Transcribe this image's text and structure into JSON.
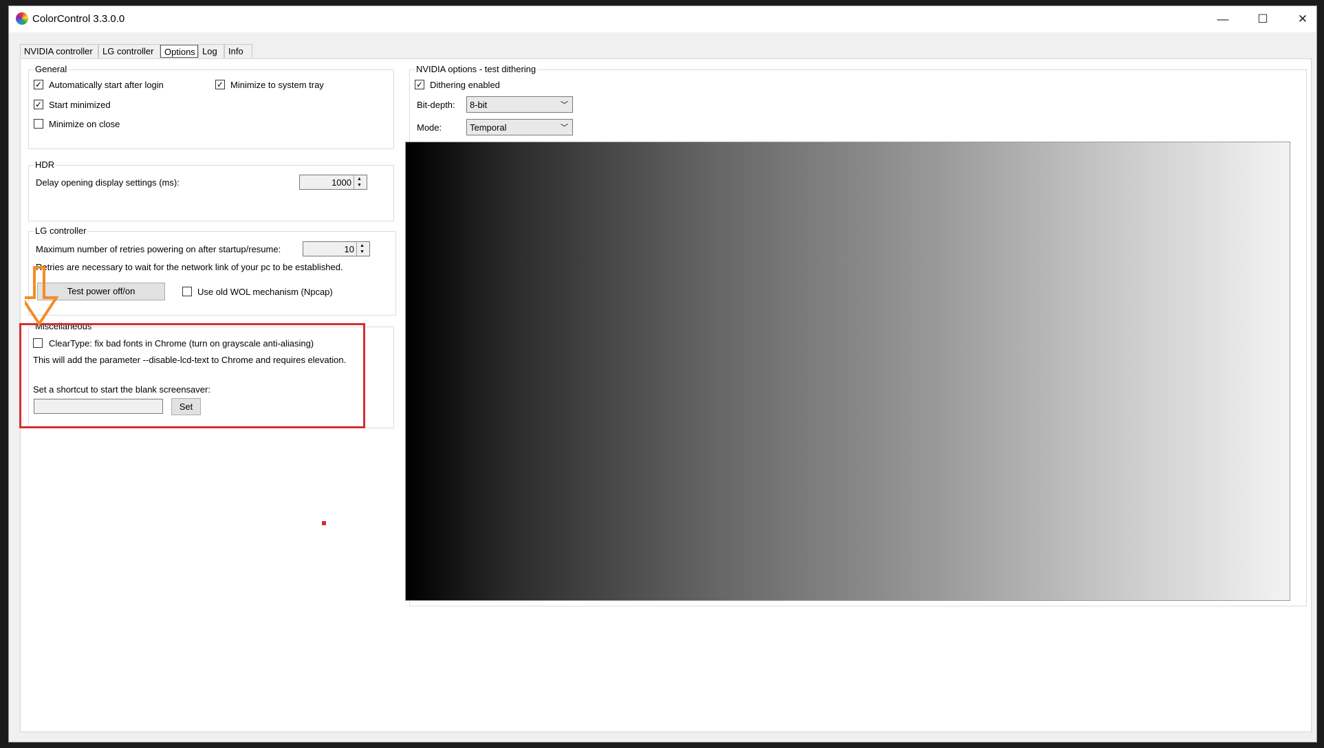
{
  "window": {
    "title": "ColorControl 3.3.0.0",
    "controls": {
      "minimize": "—",
      "maximize": "☐",
      "close": "✕"
    }
  },
  "tabs": [
    {
      "label": "NVIDIA controller",
      "active": false
    },
    {
      "label": "LG controller",
      "active": false
    },
    {
      "label": "Options",
      "active": true
    },
    {
      "label": "Log",
      "active": false
    },
    {
      "label": "Info",
      "active": false
    }
  ],
  "general": {
    "title": "General",
    "auto_start": {
      "label": "Automatically start after login",
      "checked": true
    },
    "minimize_tray": {
      "label": "Minimize to system tray",
      "checked": true
    },
    "start_minimized": {
      "label": "Start minimized",
      "checked": true
    },
    "minimize_close": {
      "label": "Minimize on close",
      "checked": false
    }
  },
  "hdr": {
    "title": "HDR",
    "delay_label": "Delay opening display settings (ms):",
    "delay_value": "1000"
  },
  "lg": {
    "title": "LG controller",
    "retries_label": "Maximum number of retries powering on after startup/resume:",
    "retries_value": "10",
    "retries_note": "Retries are necessary to wait for the network link of your pc to be established.",
    "test_button": "Test power off/on",
    "wol": {
      "label": "Use old WOL mechanism (Npcap)",
      "checked": false
    }
  },
  "misc": {
    "title": "Miscellaneous",
    "cleartype": {
      "label": "ClearType: fix bad fonts in Chrome (turn on grayscale anti-aliasing)",
      "checked": false
    },
    "cleartype_note": "This will add the parameter --disable-lcd-text to Chrome and requires elevation.",
    "shortcut_label": "Set a shortcut to start the blank screensaver:",
    "shortcut_value": "",
    "set_button": "Set"
  },
  "nvidia": {
    "title": "NVIDIA options - test dithering",
    "dithering": {
      "label": "Dithering enabled",
      "checked": true
    },
    "bitdepth_label": "Bit-depth:",
    "bitdepth_value": "8-bit",
    "mode_label": "Mode:",
    "mode_value": "Temporal"
  },
  "colors": {
    "annotation_red": "#d32f2f",
    "annotation_orange": "#f28c28"
  }
}
